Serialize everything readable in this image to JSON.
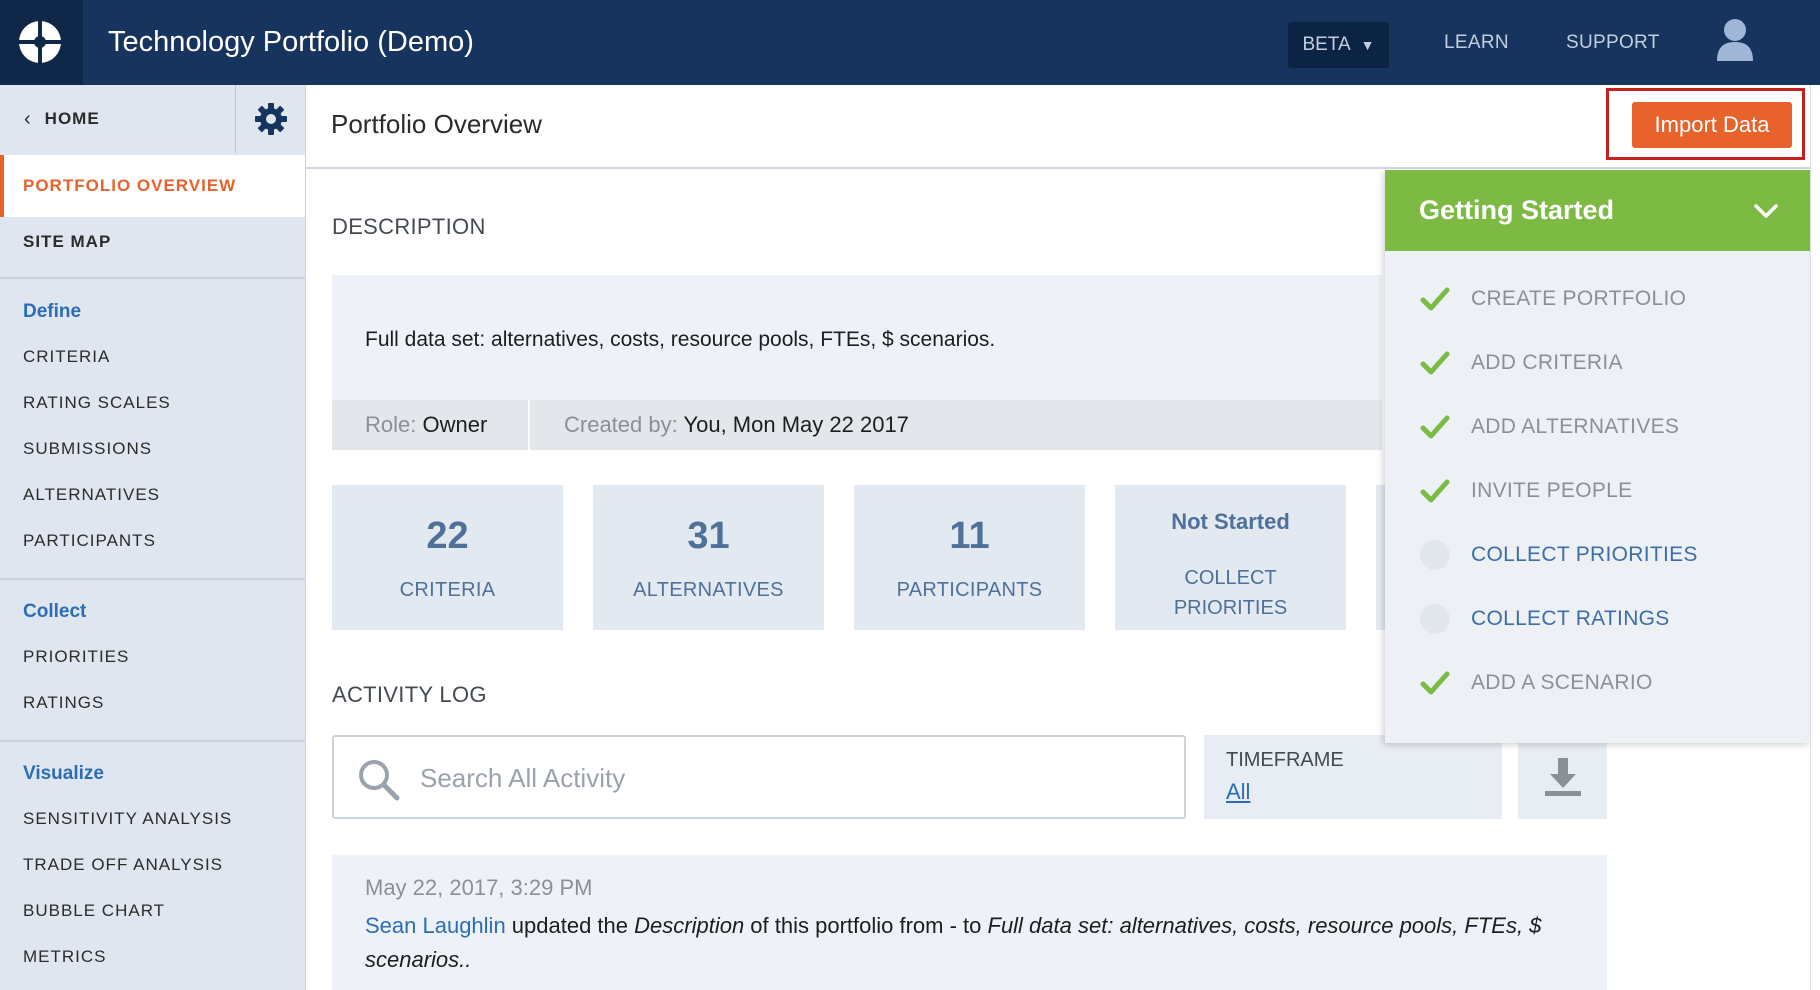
{
  "app": {
    "title": "Technology Portfolio (Demo)"
  },
  "topnav": {
    "beta": "BETA",
    "learn": "LEARN",
    "support": "SUPPORT"
  },
  "sidebar": {
    "home": "HOME",
    "active": "PORTFOLIO OVERVIEW",
    "site_map": "SITE MAP",
    "define": {
      "heading": "Define",
      "items": [
        "CRITERIA",
        "RATING SCALES",
        "SUBMISSIONS",
        "ALTERNATIVES",
        "PARTICIPANTS"
      ]
    },
    "collect": {
      "heading": "Collect",
      "items": [
        "PRIORITIES",
        "RATINGS"
      ]
    },
    "visualize": {
      "heading": "Visualize",
      "items": [
        "SENSITIVITY ANALYSIS",
        "TRADE OFF ANALYSIS",
        "BUBBLE CHART",
        "METRICS"
      ]
    }
  },
  "main": {
    "title": "Portfolio Overview",
    "import_button": "Import Data",
    "description_heading": "DESCRIPTION",
    "description": "Full data set: alternatives, costs, resource pools, FTEs, $ scenarios.",
    "role_key": "Role:",
    "role_value": "Owner",
    "created_key": "Created by:",
    "created_value": "You, Mon May 22 2017",
    "stats": [
      {
        "value": "22",
        "label": "CRITERIA"
      },
      {
        "value": "31",
        "label": "ALTERNATIVES"
      },
      {
        "value": "11",
        "label": "PARTICIPANTS"
      }
    ],
    "status_card": {
      "status": "Not Started",
      "label_line1": "COLLECT",
      "label_line2": "PRIORITIES"
    },
    "activity_heading": "ACTIVITY LOG",
    "search_placeholder": "Search All Activity",
    "timeframe_label": "TIMEFRAME",
    "timeframe_value": "All",
    "log": {
      "time": "May 22, 2017, 3:29 PM",
      "user": "Sean Laughlin",
      "text1": " updated the ",
      "field": "Description",
      "text2": " of this portfolio from - to ",
      "new_value": "Full data set: alternatives, costs, resource pools, FTEs, $ scenarios.."
    }
  },
  "getting_started": {
    "title": "Getting Started",
    "steps": [
      {
        "label": "CREATE PORTFOLIO",
        "done": true
      },
      {
        "label": "ADD CRITERIA",
        "done": true
      },
      {
        "label": "ADD ALTERNATIVES",
        "done": true
      },
      {
        "label": "INVITE PEOPLE",
        "done": true
      },
      {
        "label": "COLLECT PRIORITIES",
        "done": false
      },
      {
        "label": "COLLECT RATINGS",
        "done": false
      },
      {
        "label": "ADD A SCENARIO",
        "done": true
      }
    ]
  },
  "colors": {
    "topbar": "#16345e",
    "accent": "#e8622c",
    "success": "#7dba43",
    "link": "#2c6db5"
  }
}
